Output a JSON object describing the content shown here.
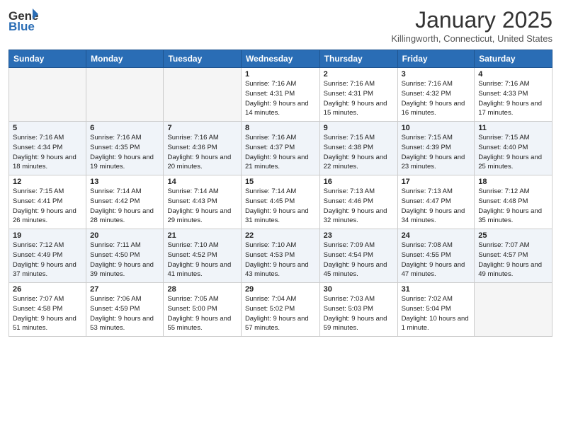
{
  "header": {
    "logo_line1": "General",
    "logo_line2": "Blue",
    "month": "January 2025",
    "location": "Killingworth, Connecticut, United States"
  },
  "weekdays": [
    "Sunday",
    "Monday",
    "Tuesday",
    "Wednesday",
    "Thursday",
    "Friday",
    "Saturday"
  ],
  "weeks": [
    [
      {
        "day": "",
        "sunrise": "",
        "sunset": "",
        "daylight": ""
      },
      {
        "day": "",
        "sunrise": "",
        "sunset": "",
        "daylight": ""
      },
      {
        "day": "",
        "sunrise": "",
        "sunset": "",
        "daylight": ""
      },
      {
        "day": "1",
        "sunrise": "Sunrise: 7:16 AM",
        "sunset": "Sunset: 4:31 PM",
        "daylight": "Daylight: 9 hours and 14 minutes."
      },
      {
        "day": "2",
        "sunrise": "Sunrise: 7:16 AM",
        "sunset": "Sunset: 4:31 PM",
        "daylight": "Daylight: 9 hours and 15 minutes."
      },
      {
        "day": "3",
        "sunrise": "Sunrise: 7:16 AM",
        "sunset": "Sunset: 4:32 PM",
        "daylight": "Daylight: 9 hours and 16 minutes."
      },
      {
        "day": "4",
        "sunrise": "Sunrise: 7:16 AM",
        "sunset": "Sunset: 4:33 PM",
        "daylight": "Daylight: 9 hours and 17 minutes."
      }
    ],
    [
      {
        "day": "5",
        "sunrise": "Sunrise: 7:16 AM",
        "sunset": "Sunset: 4:34 PM",
        "daylight": "Daylight: 9 hours and 18 minutes."
      },
      {
        "day": "6",
        "sunrise": "Sunrise: 7:16 AM",
        "sunset": "Sunset: 4:35 PM",
        "daylight": "Daylight: 9 hours and 19 minutes."
      },
      {
        "day": "7",
        "sunrise": "Sunrise: 7:16 AM",
        "sunset": "Sunset: 4:36 PM",
        "daylight": "Daylight: 9 hours and 20 minutes."
      },
      {
        "day": "8",
        "sunrise": "Sunrise: 7:16 AM",
        "sunset": "Sunset: 4:37 PM",
        "daylight": "Daylight: 9 hours and 21 minutes."
      },
      {
        "day": "9",
        "sunrise": "Sunrise: 7:15 AM",
        "sunset": "Sunset: 4:38 PM",
        "daylight": "Daylight: 9 hours and 22 minutes."
      },
      {
        "day": "10",
        "sunrise": "Sunrise: 7:15 AM",
        "sunset": "Sunset: 4:39 PM",
        "daylight": "Daylight: 9 hours and 23 minutes."
      },
      {
        "day": "11",
        "sunrise": "Sunrise: 7:15 AM",
        "sunset": "Sunset: 4:40 PM",
        "daylight": "Daylight: 9 hours and 25 minutes."
      }
    ],
    [
      {
        "day": "12",
        "sunrise": "Sunrise: 7:15 AM",
        "sunset": "Sunset: 4:41 PM",
        "daylight": "Daylight: 9 hours and 26 minutes."
      },
      {
        "day": "13",
        "sunrise": "Sunrise: 7:14 AM",
        "sunset": "Sunset: 4:42 PM",
        "daylight": "Daylight: 9 hours and 28 minutes."
      },
      {
        "day": "14",
        "sunrise": "Sunrise: 7:14 AM",
        "sunset": "Sunset: 4:43 PM",
        "daylight": "Daylight: 9 hours and 29 minutes."
      },
      {
        "day": "15",
        "sunrise": "Sunrise: 7:14 AM",
        "sunset": "Sunset: 4:45 PM",
        "daylight": "Daylight: 9 hours and 31 minutes."
      },
      {
        "day": "16",
        "sunrise": "Sunrise: 7:13 AM",
        "sunset": "Sunset: 4:46 PM",
        "daylight": "Daylight: 9 hours and 32 minutes."
      },
      {
        "day": "17",
        "sunrise": "Sunrise: 7:13 AM",
        "sunset": "Sunset: 4:47 PM",
        "daylight": "Daylight: 9 hours and 34 minutes."
      },
      {
        "day": "18",
        "sunrise": "Sunrise: 7:12 AM",
        "sunset": "Sunset: 4:48 PM",
        "daylight": "Daylight: 9 hours and 35 minutes."
      }
    ],
    [
      {
        "day": "19",
        "sunrise": "Sunrise: 7:12 AM",
        "sunset": "Sunset: 4:49 PM",
        "daylight": "Daylight: 9 hours and 37 minutes."
      },
      {
        "day": "20",
        "sunrise": "Sunrise: 7:11 AM",
        "sunset": "Sunset: 4:50 PM",
        "daylight": "Daylight: 9 hours and 39 minutes."
      },
      {
        "day": "21",
        "sunrise": "Sunrise: 7:10 AM",
        "sunset": "Sunset: 4:52 PM",
        "daylight": "Daylight: 9 hours and 41 minutes."
      },
      {
        "day": "22",
        "sunrise": "Sunrise: 7:10 AM",
        "sunset": "Sunset: 4:53 PM",
        "daylight": "Daylight: 9 hours and 43 minutes."
      },
      {
        "day": "23",
        "sunrise": "Sunrise: 7:09 AM",
        "sunset": "Sunset: 4:54 PM",
        "daylight": "Daylight: 9 hours and 45 minutes."
      },
      {
        "day": "24",
        "sunrise": "Sunrise: 7:08 AM",
        "sunset": "Sunset: 4:55 PM",
        "daylight": "Daylight: 9 hours and 47 minutes."
      },
      {
        "day": "25",
        "sunrise": "Sunrise: 7:07 AM",
        "sunset": "Sunset: 4:57 PM",
        "daylight": "Daylight: 9 hours and 49 minutes."
      }
    ],
    [
      {
        "day": "26",
        "sunrise": "Sunrise: 7:07 AM",
        "sunset": "Sunset: 4:58 PM",
        "daylight": "Daylight: 9 hours and 51 minutes."
      },
      {
        "day": "27",
        "sunrise": "Sunrise: 7:06 AM",
        "sunset": "Sunset: 4:59 PM",
        "daylight": "Daylight: 9 hours and 53 minutes."
      },
      {
        "day": "28",
        "sunrise": "Sunrise: 7:05 AM",
        "sunset": "Sunset: 5:00 PM",
        "daylight": "Daylight: 9 hours and 55 minutes."
      },
      {
        "day": "29",
        "sunrise": "Sunrise: 7:04 AM",
        "sunset": "Sunset: 5:02 PM",
        "daylight": "Daylight: 9 hours and 57 minutes."
      },
      {
        "day": "30",
        "sunrise": "Sunrise: 7:03 AM",
        "sunset": "Sunset: 5:03 PM",
        "daylight": "Daylight: 9 hours and 59 minutes."
      },
      {
        "day": "31",
        "sunrise": "Sunrise: 7:02 AM",
        "sunset": "Sunset: 5:04 PM",
        "daylight": "Daylight: 10 hours and 1 minute."
      },
      {
        "day": "",
        "sunrise": "",
        "sunset": "",
        "daylight": ""
      }
    ]
  ]
}
